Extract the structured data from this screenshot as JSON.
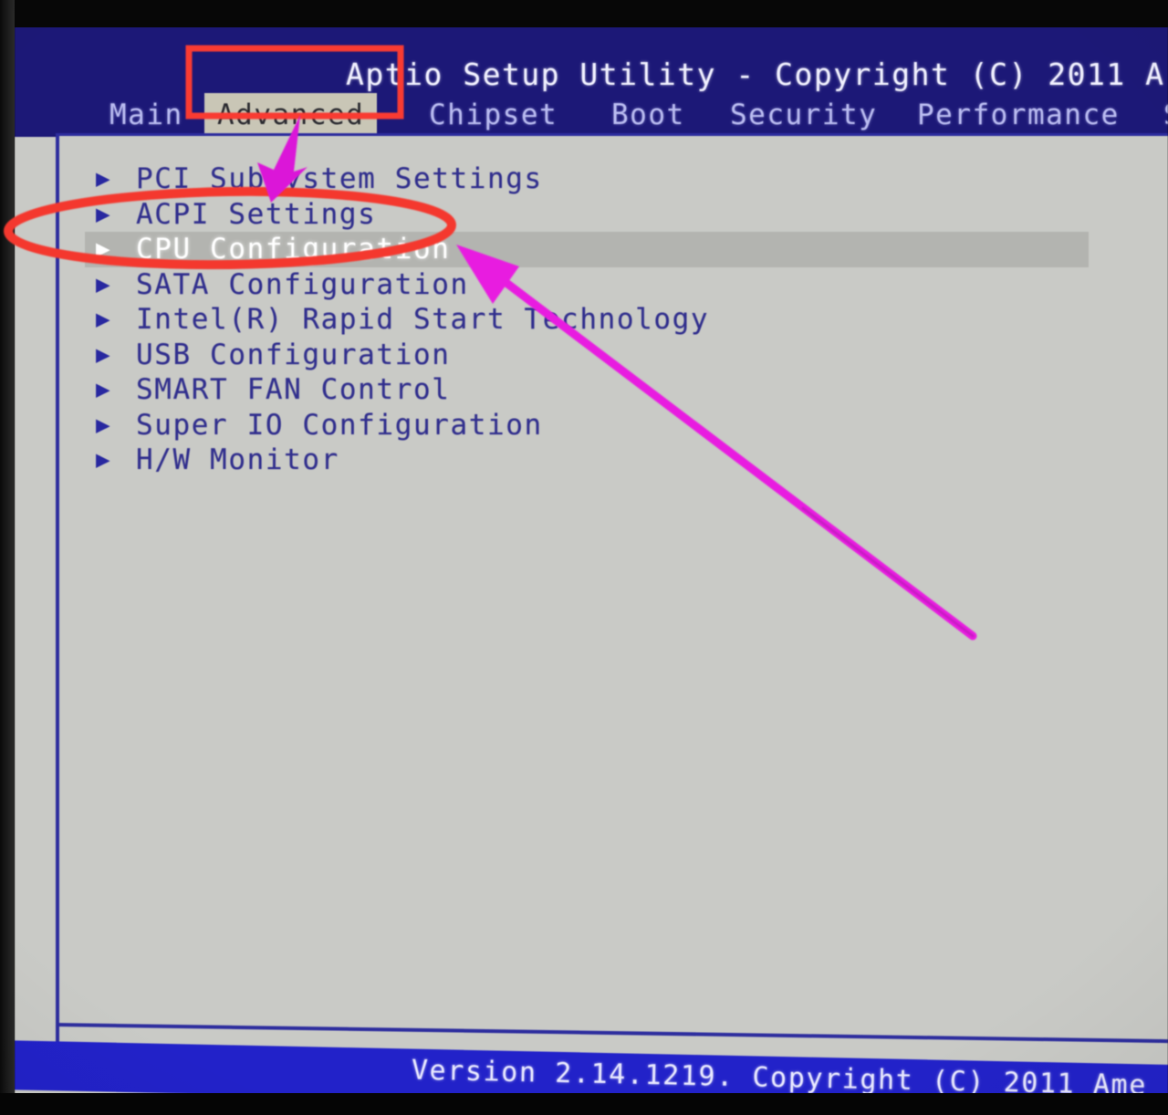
{
  "window": {
    "title": "Aptio Setup Utility - Copyright (C) 2011 A",
    "version_bar": "Version 2.14.1219. Copyright (C) 2011 Ame"
  },
  "menubar": {
    "tabs": [
      {
        "label": "Main",
        "selected": false
      },
      {
        "label": "Advanced",
        "selected": true
      },
      {
        "label": "Chipset",
        "selected": false
      },
      {
        "label": "Boot",
        "selected": false
      },
      {
        "label": "Security",
        "selected": false
      },
      {
        "label": "Performance",
        "selected": false
      },
      {
        "label": "S",
        "selected": false
      }
    ]
  },
  "main": {
    "items": [
      {
        "label": "PCI Subsystem Settings",
        "bullet": "▶",
        "selected": false
      },
      {
        "label": "ACPI Settings",
        "bullet": "▶",
        "selected": false
      },
      {
        "label": "CPU Configuration",
        "bullet": "▶",
        "selected": true
      },
      {
        "label": "SATA Configuration",
        "bullet": "▶",
        "selected": false
      },
      {
        "label": "Intel(R) Rapid Start Technology",
        "bullet": "▶",
        "selected": false
      },
      {
        "label": "USB Configuration",
        "bullet": "▶",
        "selected": false
      },
      {
        "label": "SMART FAN Control",
        "bullet": "▶",
        "selected": false
      },
      {
        "label": "Super IO Configuration",
        "bullet": "▶",
        "selected": false
      },
      {
        "label": "H/W Monitor",
        "bullet": "▶",
        "selected": false
      }
    ]
  },
  "annotations": {
    "highlight_color_red": "#f93b33",
    "highlight_color_magenta": "#e81ce0",
    "rectangle_target": "Advanced",
    "ellipse_target": "CPU Configuration",
    "arrow_long_target": "CPU Configuration",
    "arrow_short_target": "Advanced"
  },
  "colors": {
    "header_blue": "#1c1877",
    "footer_blue": "#2222c9",
    "panel_grey": "#c9cac6",
    "tab_selected_bg": "#c9c6b6",
    "row_text_blue": "#312f8e",
    "row_selected_bg": "#b3b4b0"
  }
}
